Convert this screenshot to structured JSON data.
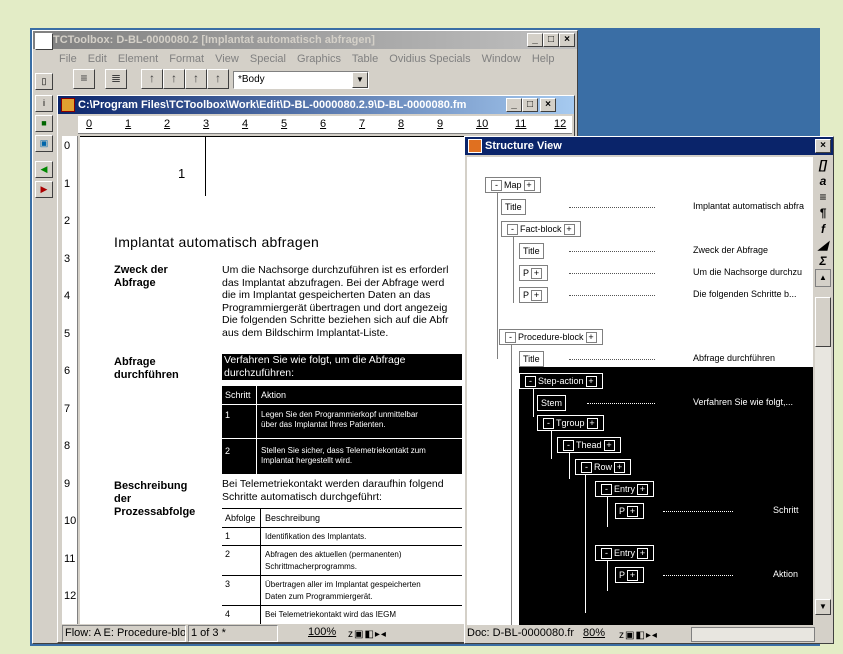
{
  "app": {
    "title": "TCToolbox: D-BL-0000080.2 [Implantat automatisch abfragen]",
    "menu": [
      "File",
      "Edit",
      "Element",
      "Format",
      "View",
      "Special",
      "Graphics",
      "Table",
      "Ovidius Specials",
      "Window",
      "Help"
    ],
    "element_select": "*Body"
  },
  "doc": {
    "title": "C:\\Program Files\\TCToolbox\\Work\\Edit\\D-BL-0000080.2.9\\D-BL-0000080.fm",
    "ruler_nums": [
      "0",
      "1",
      "2",
      "3",
      "4",
      "5",
      "6",
      "7",
      "8",
      "9",
      "10",
      "11",
      "12"
    ],
    "side_nums": [
      "0",
      "1",
      "2",
      "3",
      "4",
      "5",
      "6",
      "7",
      "8",
      "9",
      "10",
      "11",
      "12",
      "13"
    ],
    "page_number": "1",
    "heading": "Implantat automatisch abfragen",
    "sec1_label": "Zweck der Abfrage",
    "sec1_lines": [
      "Um die Nachsorge durchzuführen ist es erforderl",
      "das Implantat abzufragen.  Bei der Abfrage werd",
      "die im Implantat gespeicherten Daten an das",
      "Programmiergerät übertragen und dort angezeig",
      "Die folgenden Schritte beziehen sich auf die  Abfr",
      "aus dem Bildschirm Implantat-Liste."
    ],
    "sec2_label": "Abfrage durchführen",
    "sec2_intro_lines": [
      "Verfahren Sie wie folgt, um die Abfrage",
      "durchzuführen:"
    ],
    "t1_head": [
      "Schritt",
      "Aktion"
    ],
    "t1_rows": [
      {
        "n": "1",
        "l1": "Legen Sie den Programmierkopf unmittelbar",
        "l2": "über das Implantat Ihres Patienten."
      },
      {
        "n": "2",
        "l1": "Stellen Sie sicher, dass Telemetriekontakt zum",
        "l2": "Implantat hergestellt wird."
      }
    ],
    "sec3_label": "Beschreibung der Prozessabfolge",
    "sec3_lines": [
      "Bei Telemetriekontakt werden daraufhin folgend",
      "Schritte automatisch durchgeführt:"
    ],
    "t2_head": [
      "Abfolge",
      "Beschreibung"
    ],
    "t2_rows": [
      {
        "n": "1",
        "l1": "Identifikation des Implantats.",
        "l2": ""
      },
      {
        "n": "2",
        "l1": "Abfragen des aktuellen (permanenten)",
        "l2": "Schrittmacherprogramms."
      },
      {
        "n": "3",
        "l1": "Übertragen aller im Implantat gespeicherten",
        "l2": "Daten zum Programmiergerät."
      },
      {
        "n": "4",
        "l1": "Bei Telemetriekontakt wird das IEGM",
        "l2": ""
      }
    ],
    "status_flow": "Flow: A  E: Procedure-blo",
    "status_page": "1 of 3 *",
    "zoom": "100%"
  },
  "structure": {
    "title": "Structure View",
    "nodes": {
      "map": "Map",
      "title1": "Title",
      "fact": "Fact-block",
      "title2": "Title",
      "p1": "P",
      "p2": "P",
      "proc": "Procedure-block",
      "title3": "Title",
      "step": "Step-action",
      "stem": "Stem",
      "tgroup": "Tgroup",
      "thead": "Thead",
      "row": "Row",
      "entry1": "Entry",
      "p3": "P",
      "entry2": "Entry",
      "p4": "P"
    },
    "texts": {
      "title1": "Implantat automatisch abfra",
      "title2": "Zweck der Abfrage",
      "p1": "Um die Nachsorge durchzu",
      "p2": "Die folgenden Schritte b...",
      "title3": "Abfrage durchführen",
      "stem": "Verfahren Sie wie folgt,...",
      "p3": "Schritt",
      "p4": "Aktion"
    },
    "status_doc": "Doc: D-BL-0000080.fr",
    "zoom": "80%",
    "tools": [
      "[]",
      "a",
      "≡",
      "¶",
      "f",
      "◢",
      "Σ",
      "▲"
    ]
  }
}
